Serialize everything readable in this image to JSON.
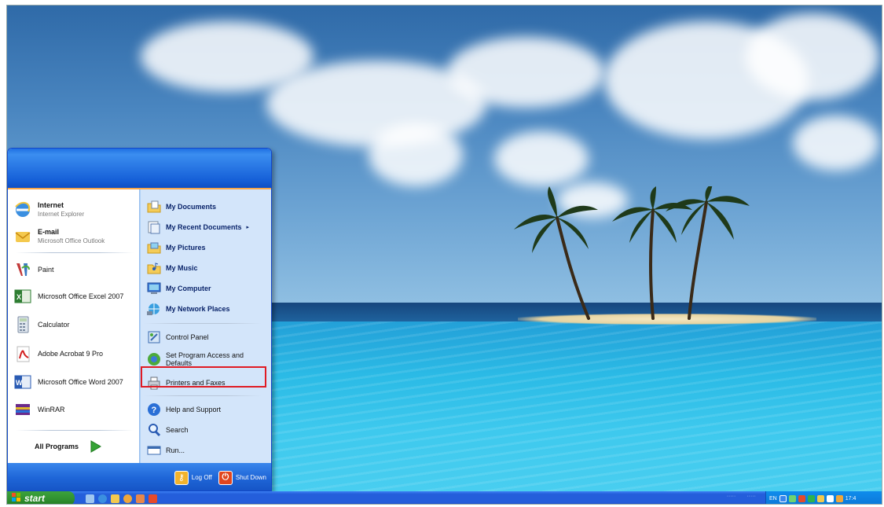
{
  "start_menu": {
    "left_items": [
      {
        "title": "Internet",
        "subtitle": "Internet Explorer",
        "bold": true,
        "icon": "internet-explorer-icon"
      },
      {
        "title": "E-mail",
        "subtitle": "Microsoft Office Outlook",
        "bold": true,
        "icon": "outlook-icon"
      },
      {
        "title": "Paint",
        "subtitle": "",
        "bold": false,
        "icon": "paint-icon"
      },
      {
        "title": "Microsoft Office Excel 2007",
        "subtitle": "",
        "bold": false,
        "icon": "excel-icon"
      },
      {
        "title": "Calculator",
        "subtitle": "",
        "bold": false,
        "icon": "calculator-icon"
      },
      {
        "title": "Adobe Acrobat 9 Pro",
        "subtitle": "",
        "bold": false,
        "icon": "acrobat-icon"
      },
      {
        "title": "Microsoft Office Word 2007",
        "subtitle": "",
        "bold": false,
        "icon": "word-icon"
      },
      {
        "title": "WinRAR",
        "subtitle": "",
        "bold": false,
        "icon": "winrar-icon"
      }
    ],
    "all_programs_label": "All Programs",
    "right_items": [
      {
        "label": "My Documents",
        "bold": true,
        "icon": "folder-documents-icon"
      },
      {
        "label": "My Recent Documents",
        "bold": true,
        "icon": "recent-documents-icon",
        "submenu": "▸"
      },
      {
        "label": "My Pictures",
        "bold": true,
        "icon": "folder-pictures-icon"
      },
      {
        "label": "My Music",
        "bold": true,
        "icon": "folder-music-icon"
      },
      {
        "label": "My Computer",
        "bold": true,
        "icon": "computer-icon"
      },
      {
        "label": "My Network Places",
        "bold": true,
        "icon": "network-places-icon"
      },
      {
        "label": "Control Panel",
        "bold": false,
        "icon": "control-panel-icon"
      },
      {
        "label": "Set Program Access and Defaults",
        "bold": false,
        "icon": "program-defaults-icon"
      },
      {
        "label": "Printers and Faxes",
        "bold": false,
        "icon": "printer-icon"
      },
      {
        "label": "Help and Support",
        "bold": false,
        "icon": "help-icon"
      },
      {
        "label": "Search",
        "bold": false,
        "icon": "search-icon"
      },
      {
        "label": "Run...",
        "bold": false,
        "icon": "run-icon"
      }
    ],
    "footer": {
      "logoff_label": "Log Off",
      "shutdown_label": "Shut Down"
    }
  },
  "taskbar": {
    "start_label": "start",
    "tray_language": "EN",
    "clock": "17:4"
  },
  "colors": {
    "xp_blue": "#245edb",
    "start_green": "#2f8f2f",
    "highlight_red": "#e01b24"
  }
}
